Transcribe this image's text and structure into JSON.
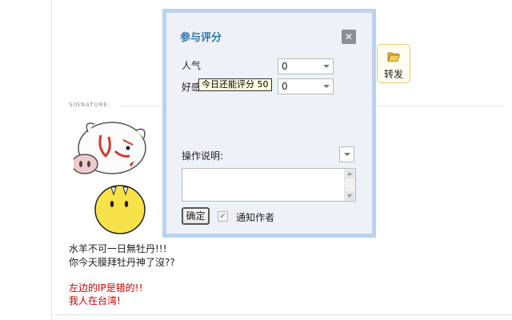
{
  "signature": {
    "label": "SIGNATURE:",
    "lines": [
      "水羊不可一日無牡丹!!!",
      "你今天膜拜牡丹神了沒??"
    ],
    "red_lines": [
      "左边的IP是错的!!",
      "我人在台湾!"
    ]
  },
  "forward": {
    "label": "转发",
    "icon": "folder-open-icon"
  },
  "dialog": {
    "title": "参与评分",
    "close_glyph": "✕",
    "rows": [
      {
        "label": "人气",
        "value": "0"
      },
      {
        "label": "好感",
        "value": "0"
      }
    ],
    "tooltip": "今日还能评分 50",
    "operation_label": "操作说明:",
    "ok_label": "确定",
    "notify_label": "通知作者",
    "notify_checked": true
  },
  "colors": {
    "dialog_border": "#b9d3ef",
    "dialog_bg": "#eef2f8",
    "title": "#2c78b0",
    "red_text": "#cc0000",
    "forward_border": "#e8c96a"
  }
}
